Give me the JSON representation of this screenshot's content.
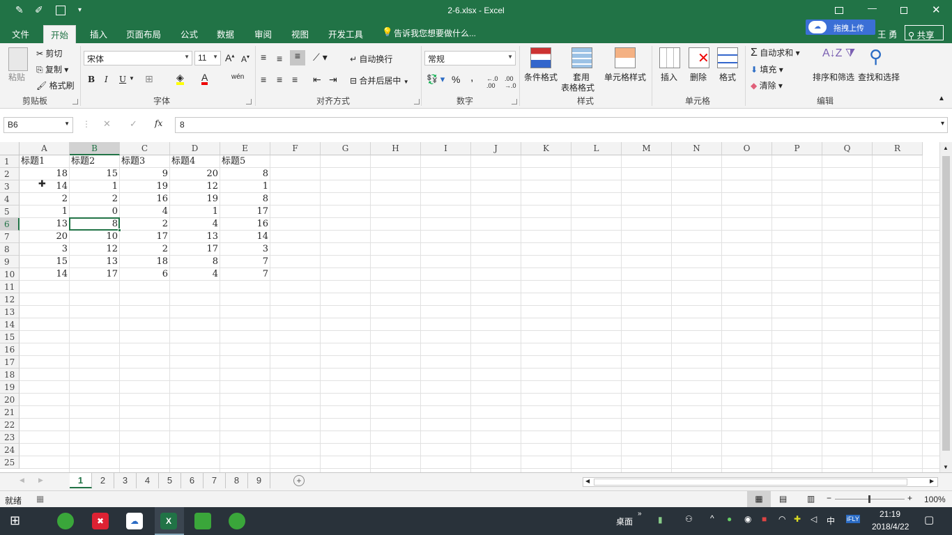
{
  "window": {
    "title": "2-6.xlsx - Excel",
    "user": "王 勇",
    "share_label": "共享",
    "upload_label": "拖拽上传"
  },
  "tabs": [
    "文件",
    "开始",
    "插入",
    "页面布局",
    "公式",
    "数据",
    "审阅",
    "视图",
    "开发工具"
  ],
  "active_tab": "开始",
  "tell_me": "告诉我您想要做什么...",
  "ribbon": {
    "clipboard": {
      "paste": "粘贴",
      "cut": "剪切",
      "copy": "复制",
      "format_painter": "格式刷",
      "label": "剪贴板"
    },
    "font": {
      "name": "宋体",
      "size": "11",
      "bold": "B",
      "italic": "I",
      "underline": "U",
      "label": "字体"
    },
    "alignment": {
      "wrap": "自动换行",
      "merge": "合并后居中",
      "label": "对齐方式"
    },
    "number": {
      "format": "常规",
      "percent": "%",
      "comma": ",",
      "label": "数字"
    },
    "styles": {
      "conditional": "条件格式",
      "table1": "套用",
      "table2": "表格格式",
      "cell_styles": "单元格样式",
      "label": "样式"
    },
    "cells": {
      "insert": "插入",
      "delete": "删除",
      "format": "格式",
      "label": "单元格"
    },
    "editing": {
      "autosum": "自动求和",
      "fill": "填充",
      "clear": "清除",
      "sort": "排序和筛选",
      "find": "查找和选择",
      "label": "编辑"
    }
  },
  "formula_bar": {
    "name_box": "B6",
    "fx": "fx",
    "value": "8"
  },
  "columns": [
    "A",
    "B",
    "C",
    "D",
    "E",
    "F",
    "G",
    "H",
    "I",
    "J",
    "K",
    "L",
    "M",
    "N",
    "O",
    "P",
    "Q",
    "R"
  ],
  "selected_column": "B",
  "selected_row": 6,
  "headers": [
    "标题1",
    "标题2",
    "标题3",
    "标题4",
    "标题5"
  ],
  "rows": [
    [
      18,
      15,
      9,
      20,
      8
    ],
    [
      14,
      1,
      19,
      12,
      1
    ],
    [
      2,
      2,
      16,
      19,
      8
    ],
    [
      1,
      0,
      4,
      1,
      17
    ],
    [
      13,
      8,
      2,
      4,
      16
    ],
    [
      20,
      10,
      17,
      13,
      14
    ],
    [
      3,
      12,
      2,
      17,
      3
    ],
    [
      15,
      13,
      18,
      8,
      7
    ],
    [
      14,
      17,
      6,
      4,
      7
    ]
  ],
  "row_count": 25,
  "sheets": [
    "1",
    "2",
    "3",
    "4",
    "5",
    "6",
    "7",
    "8",
    "9"
  ],
  "active_sheet": "1",
  "status": {
    "ready": "就绪",
    "zoom": "100%"
  },
  "taskbar": {
    "desktop": "桌面",
    "ime": "中",
    "time": "21:19",
    "date": "2018/4/22"
  },
  "colors": {
    "excel_green": "#217346",
    "taskbar": "#29323a"
  }
}
